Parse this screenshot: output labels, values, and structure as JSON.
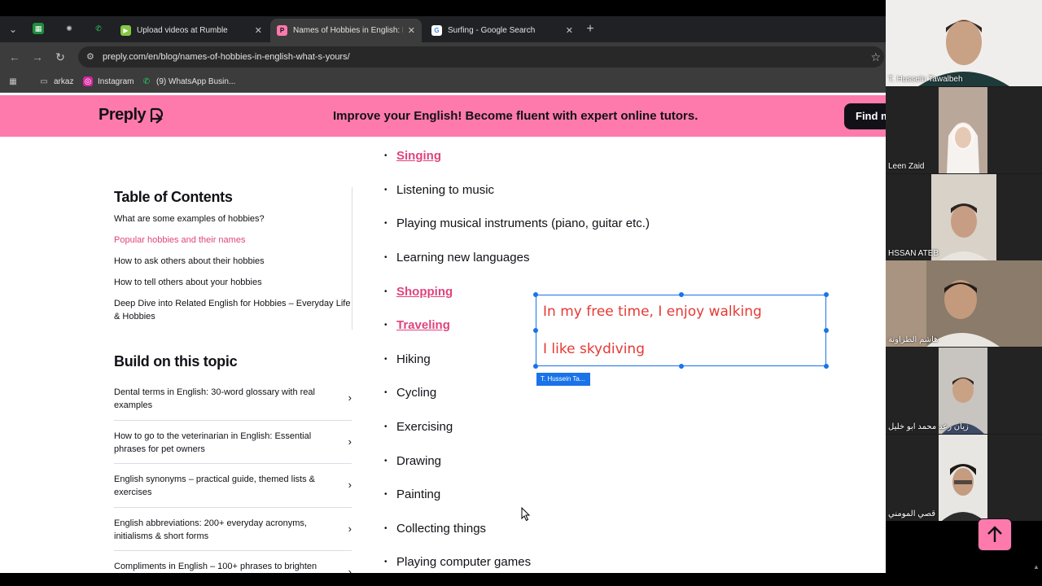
{
  "browser": {
    "tabs": [
      {
        "title": "Upload videos at Rumble",
        "active": false
      },
      {
        "title": "Names of Hobbies in English: List",
        "active": true
      },
      {
        "title": "Surfing - Google Search",
        "active": false
      }
    ],
    "url": "preply.com/en/blog/names-of-hobbies-in-english-what-s-yours/",
    "bookmarks": [
      "arkaz",
      "Instagram",
      "(9) WhatsApp Busin..."
    ]
  },
  "banner": {
    "logo": "Preply",
    "message": "Improve your English! Become fluent with expert online tutors.",
    "cta": "Find my tutor"
  },
  "toc": {
    "heading": "Table of Contents",
    "items": [
      {
        "label": "What are some examples of hobbies?",
        "active": false
      },
      {
        "label": "Popular hobbies and their names",
        "active": true
      },
      {
        "label": "How to ask others about their hobbies",
        "active": false
      },
      {
        "label": "How to tell others about your hobbies",
        "active": false
      },
      {
        "label": "Deep Dive into Related English for Hobbies – Everyday Life & Hobbies",
        "active": false
      }
    ]
  },
  "build": {
    "heading": "Build on this topic",
    "items": [
      "Dental terms in English: 30-word glossary with real examples",
      "How to go to the veterinarian in English: Essential phrases for pet owners",
      "English synonyms – practical guide, themed lists & exercises",
      "English abbreviations: 200+ everyday acronyms, initialisms & short forms",
      "Compliments in English – 100+ phrases to brighten"
    ]
  },
  "hobbies": [
    {
      "label": "Singing",
      "link": true
    },
    {
      "label": "Listening to music",
      "link": false
    },
    {
      "label": "Playing musical instruments (piano, guitar etc.)",
      "link": false
    },
    {
      "label": "Learning new languages",
      "link": false
    },
    {
      "label": "Shopping",
      "link": true
    },
    {
      "label": "Traveling",
      "link": true
    },
    {
      "label": "Hiking",
      "link": false
    },
    {
      "label": "Cycling",
      "link": false
    },
    {
      "label": "Exercising",
      "link": false
    },
    {
      "label": "Drawing",
      "link": false
    },
    {
      "label": "Painting",
      "link": false
    },
    {
      "label": "Collecting things",
      "link": false
    },
    {
      "label": "Playing computer games",
      "link": false
    }
  ],
  "annotation": {
    "lines": [
      "In my free time, I enjoy walking",
      "I like skydiving"
    ],
    "author": "T. Hussein Ta...",
    "color": "#e53935"
  },
  "participants": [
    {
      "name": "T. Hussein Tawalbeh"
    },
    {
      "name": "Leen Zaid"
    },
    {
      "name": "HSSAN ATEB"
    },
    {
      "name": "هاشم الطراونة"
    },
    {
      "name": "زيان رعد محمد ابو خليل"
    },
    {
      "name": "قصي المومني"
    }
  ],
  "colors": {
    "brand": "#ff7aac",
    "link": "#e0447d",
    "ink": "#121117"
  }
}
